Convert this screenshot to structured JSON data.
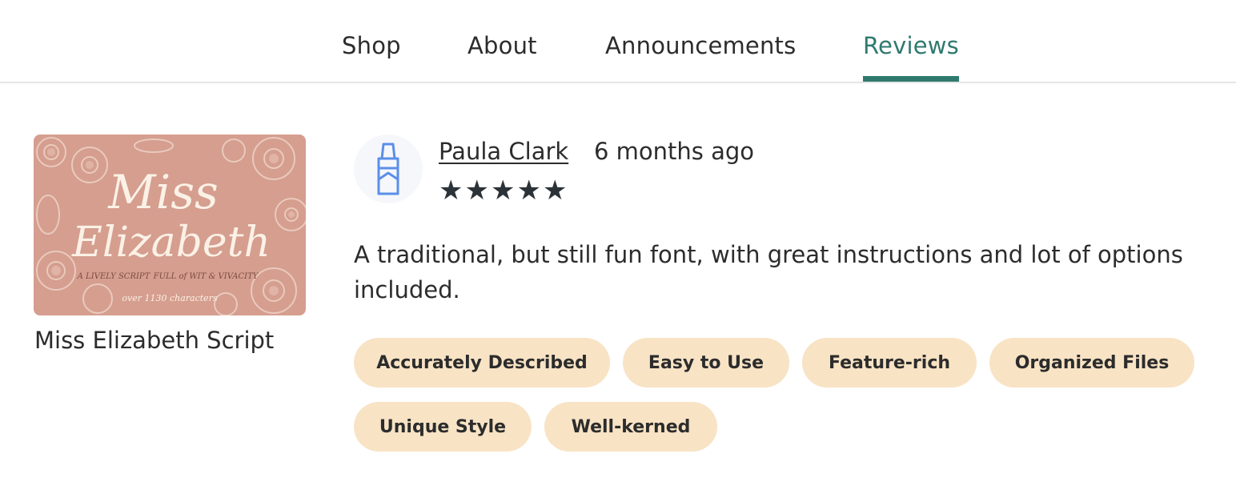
{
  "nav": {
    "tabs": [
      {
        "label": "Shop",
        "active": false
      },
      {
        "label": "About",
        "active": false
      },
      {
        "label": "Announcements",
        "active": false
      },
      {
        "label": "Reviews",
        "active": true
      }
    ]
  },
  "product": {
    "name": "Miss Elizabeth Script",
    "thumb": {
      "title_line1": "Miss",
      "title_line2": "Elizabeth",
      "tagline_left": "A LIVELY SCRIPT",
      "tagline_right": "FULL of WIT & VIVACITY",
      "footer": "over 1130 characters"
    }
  },
  "review": {
    "avatar_icon": "crayon-icon",
    "reviewer": "Paula Clark",
    "date": "6 months ago",
    "rating": 5,
    "stars": "★★★★★",
    "text": "A traditional, but still fun font, with great instructions and lot of options included.",
    "tags": [
      "Accurately Described",
      "Easy to Use",
      "Feature-rich",
      "Organized Files",
      "Unique Style",
      "Well-kerned"
    ]
  },
  "colors": {
    "accent": "#2f7a6e",
    "tag_bg": "#f8e3c5",
    "thumb_bg": "#d59e8f"
  }
}
